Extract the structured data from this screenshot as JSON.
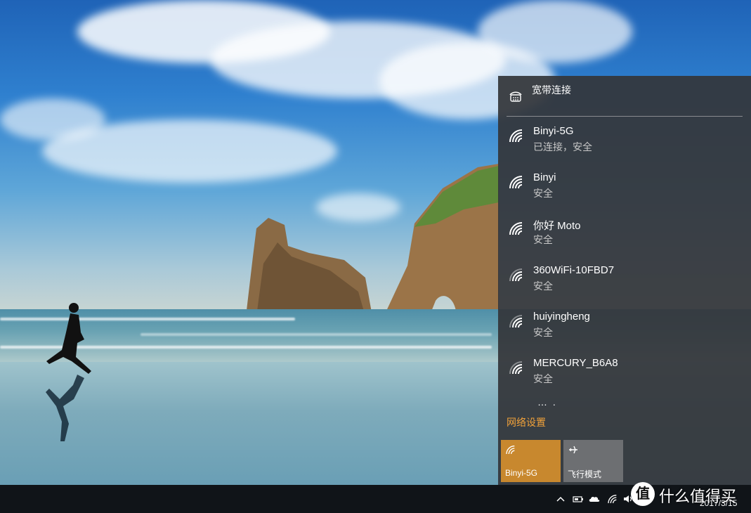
{
  "broadband": {
    "name": "宽带连接",
    "icon": "dialup-icon"
  },
  "networks": [
    {
      "ssid": "Binyi-5G",
      "status": "已连接，安全",
      "icon": "wifi-icon"
    },
    {
      "ssid": "Binyi",
      "status": "安全",
      "icon": "wifi-icon"
    },
    {
      "ssid": "你好 Moto",
      "status": "安全",
      "icon": "wifi-icon"
    },
    {
      "ssid": "360WiFi-10FBD7",
      "status": "安全",
      "icon": "wifi-icon"
    },
    {
      "ssid": "huiyingheng",
      "status": "安全",
      "icon": "wifi-icon"
    },
    {
      "ssid": "MERCURY_B6A8",
      "status": "安全",
      "icon": "wifi-icon"
    }
  ],
  "more_indicator": "…  .",
  "network_settings_label": "网络设置",
  "quick_actions": [
    {
      "label": "Binyi-5G",
      "icon": "wifi-icon",
      "active": true
    },
    {
      "label": "飞行模式",
      "icon": "airplane-icon",
      "active": false
    }
  ],
  "taskbar": {
    "date": "2017/3/15",
    "tray_icons": [
      "chevron-up-icon",
      "battery-icon",
      "onedrive-icon",
      "wifi-icon",
      "volume-icon",
      "keyboard-icon"
    ]
  },
  "watermark": {
    "badge": "值",
    "text": "什么值得买"
  },
  "colors": {
    "accent": "#c8882e",
    "link": "#f0a13a",
    "flyout_bg": "#34363a",
    "tile_inactive": "#6d6f72"
  }
}
